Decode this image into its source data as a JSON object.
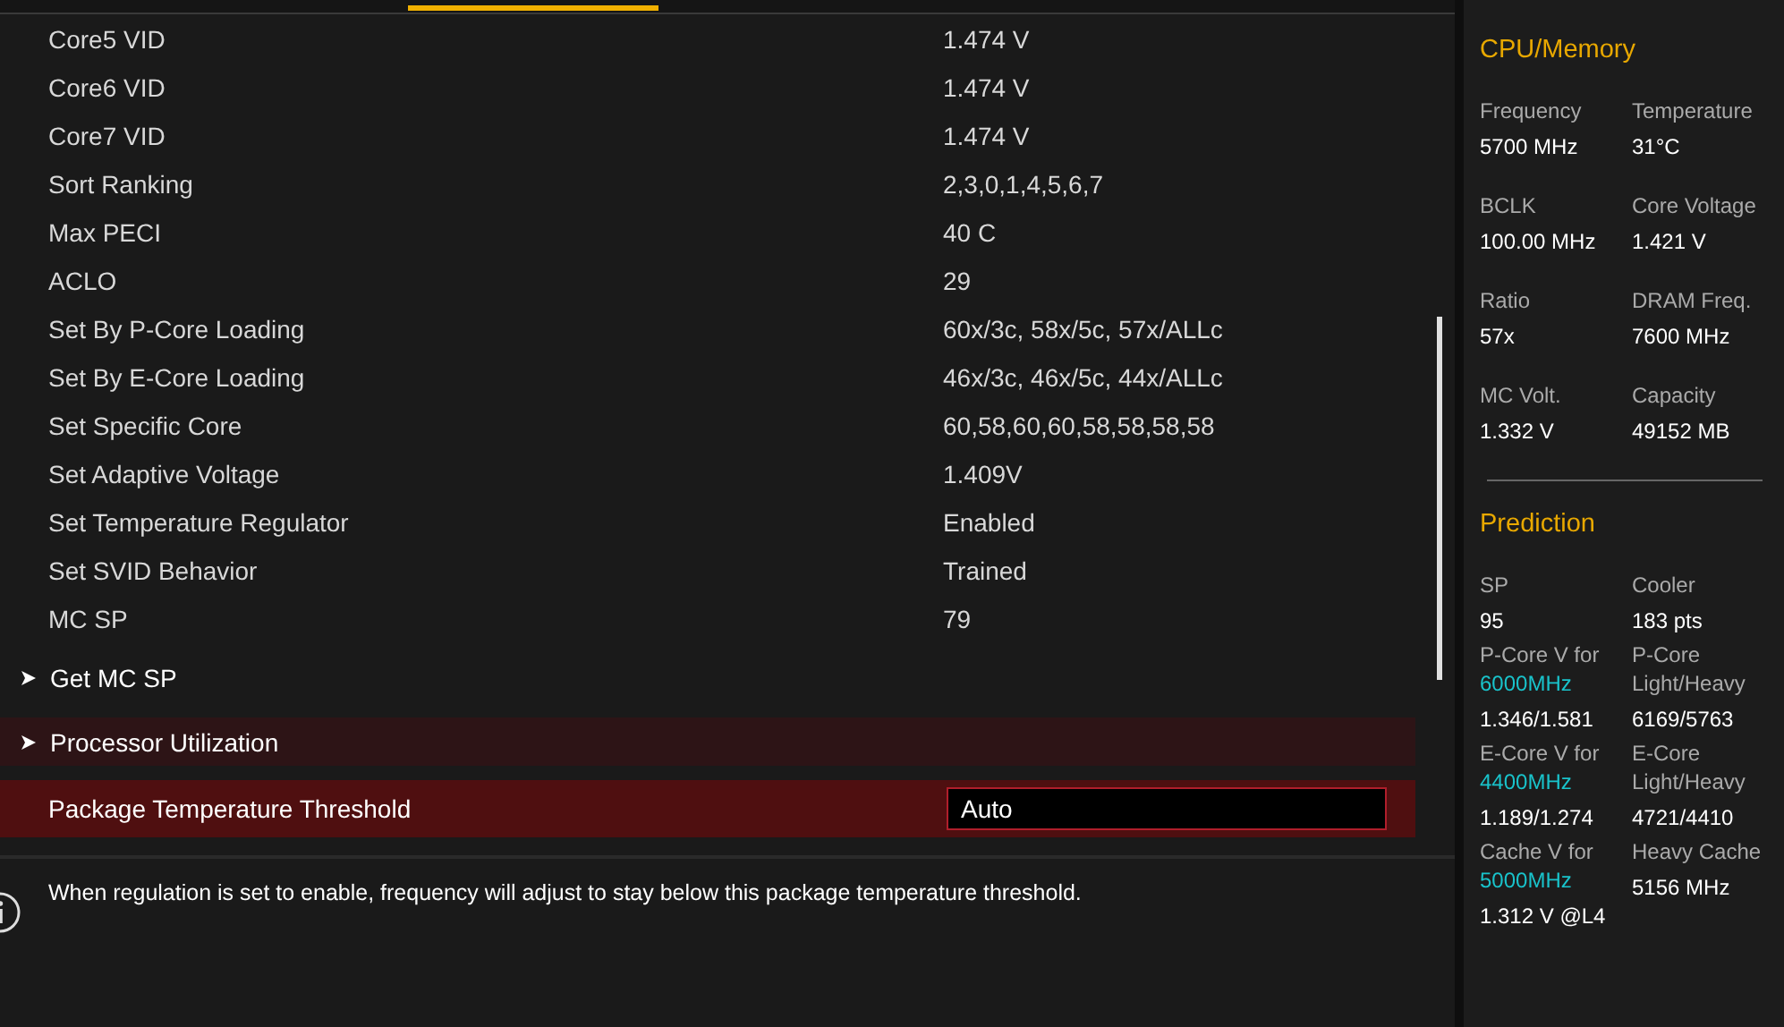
{
  "settings": [
    {
      "label": "Core5 VID",
      "value": "1.474 V"
    },
    {
      "label": "Core6 VID",
      "value": "1.474 V"
    },
    {
      "label": "Core7 VID",
      "value": "1.474 V"
    },
    {
      "label": "Sort Ranking",
      "value": "2,3,0,1,4,5,6,7"
    },
    {
      "label": "Max PECI",
      "value": "40 C"
    },
    {
      "label": "ACLO",
      "value": "29"
    },
    {
      "label": "Set By P-Core Loading",
      "value": "60x/3c, 58x/5c, 57x/ALLc"
    },
    {
      "label": "Set By E-Core Loading",
      "value": "46x/3c, 46x/5c, 44x/ALLc"
    },
    {
      "label": "Set Specific Core",
      "value": "60,58,60,60,58,58,58,58"
    },
    {
      "label": "Set Adaptive Voltage",
      "value": "1.409V"
    },
    {
      "label": "Set Temperature Regulator",
      "value": "Enabled"
    },
    {
      "label": "Set SVID Behavior",
      "value": "Trained"
    },
    {
      "label": "MC SP",
      "value": "79"
    }
  ],
  "submenus": [
    {
      "label": "Get MC SP",
      "hovered": false
    },
    {
      "label": "Processor Utilization",
      "hovered": true
    }
  ],
  "selected_setting": {
    "label": "Package Temperature Threshold",
    "value": "Auto"
  },
  "help_text": "When regulation is set to enable, frequency will adjust to stay below this package temperature threshold.",
  "hardware_monitor": {
    "sections": [
      {
        "title": "CPU/Memory",
        "items": [
          {
            "label": "Frequency",
            "value": "5700 MHz"
          },
          {
            "label": "Temperature",
            "value": "31°C"
          },
          {
            "label": "BCLK",
            "value": "100.00 MHz"
          },
          {
            "label": "Core Voltage",
            "value": "1.421 V"
          },
          {
            "label": "Ratio",
            "value": "57x"
          },
          {
            "label": "DRAM Freq.",
            "value": "7600 MHz"
          },
          {
            "label": "MC Volt.",
            "value": "1.332 V"
          },
          {
            "label": "Capacity",
            "value": "49152 MB"
          }
        ]
      },
      {
        "title": "Prediction",
        "items": [
          {
            "label": "SP",
            "value": "95"
          },
          {
            "label": "Cooler",
            "value": "183 pts"
          },
          {
            "label": "P-Core V for",
            "highlight": "6000MHz",
            "value": "1.346/1.581"
          },
          {
            "label": "P-Core Light/Heavy",
            "value": "6169/5763"
          },
          {
            "label": "E-Core V for",
            "highlight": "4400MHz",
            "value": "1.189/1.274"
          },
          {
            "label": "E-Core Light/Heavy",
            "value": "4721/4410"
          },
          {
            "label": "Cache V for",
            "highlight": "5000MHz",
            "value": "1.312 V @L4"
          },
          {
            "label": "Heavy Cache",
            "value": "5156 MHz"
          }
        ]
      }
    ]
  }
}
